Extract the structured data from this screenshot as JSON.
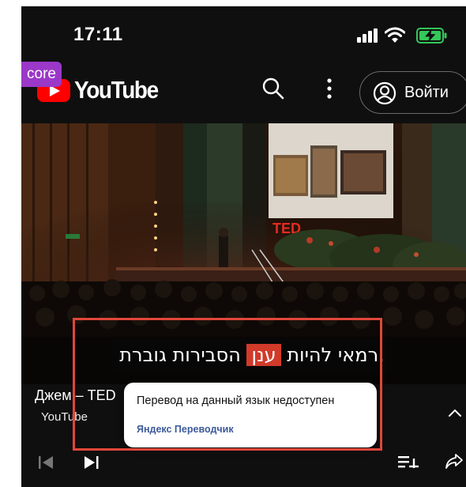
{
  "status_bar": {
    "time": "17:11",
    "icons": [
      "signal-icon",
      "wifi-icon",
      "battery-charging-icon"
    ]
  },
  "badge": {
    "label": "core",
    "color": "#9b38c8"
  },
  "header": {
    "logo_text": "YouTube",
    "logo_color": "#ff0000",
    "signin_label": "Войти",
    "icons": [
      "search-icon",
      "more-vertical-icon",
      "account-icon"
    ]
  },
  "video": {
    "stage_logo": "TED",
    "caption_before": ".רמאי להיות ",
    "caption_highlight": "ענן",
    "caption_after": " הסבירות גוברת",
    "highlight_color": "#d23a2a"
  },
  "info": {
    "title": "Джем – TED",
    "channel": "YouTube"
  },
  "popup": {
    "message": "Перевод на данный язык недоступен",
    "link": "Яндекс Переводчик",
    "link_color": "#3b5a9a"
  },
  "controls": {
    "icons": [
      "previous-icon",
      "next-icon",
      "add-to-queue-icon",
      "share-icon",
      "chevron-up-icon"
    ]
  },
  "annotation": {
    "color": "#e0463a"
  }
}
